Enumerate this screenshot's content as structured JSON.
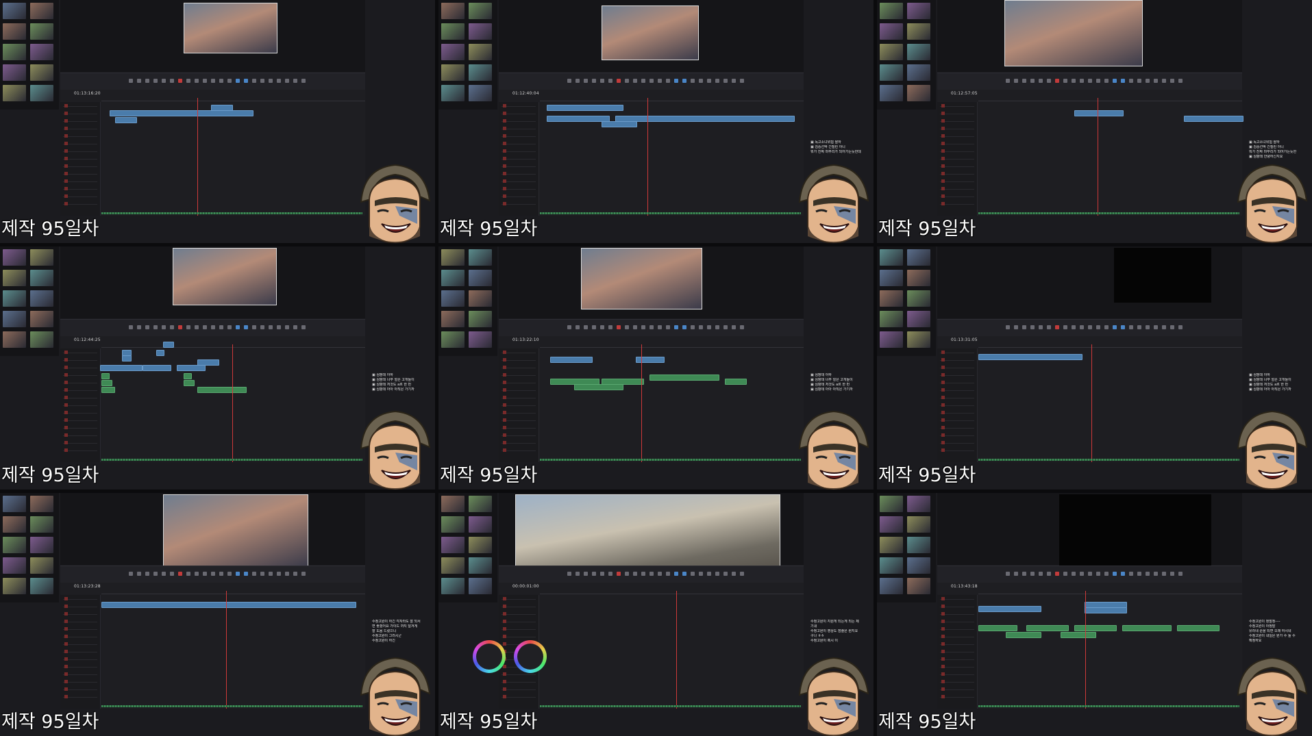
{
  "caption": "제작 95일차",
  "colors": {
    "playhead": "#d13a3a",
    "video_clip": "#4a7cab",
    "audio_clip": "#3f8a55",
    "panel_bg": "#1b1b1f"
  },
  "panels": [
    {
      "timecode": "01:13:16:20",
      "chat": []
    },
    {
      "timecode": "01:12:40:04",
      "chat": [
        "▣ 독고소녀위험 짤하",
        "▣ 김중선박 긴질린 아니",
        "뭐가 진짜 마무리가 되어가는듯한데"
      ]
    },
    {
      "timecode": "01:12:57:05",
      "chat": [
        "▣ 독고소녀위험 짤하",
        "▣ 김중선박 긴질린 아니",
        "뭐가 진짜 마무리가 되어가는듯한",
        "▣ 심팡데 안녕하신지요"
      ]
    },
    {
      "timecode": "01:12:44:25",
      "chat": [
        "▣ 심팡데 아하",
        "▣ 심팡데 너무 멀은 고개들이",
        "▣ 심팡데 저것도 a르 한 번",
        "▣ 심팡데 아아 아직은 가기까"
      ]
    },
    {
      "timecode": "01:13:22:10",
      "chat": [
        "▣ 심팡데 아하",
        "▣ 심팡데 너무 멀은 고개들이",
        "▣ 심팡데 저것도 a르 한 번",
        "▣ 심팡데 아아 아직은 가기까"
      ]
    },
    {
      "timecode": "01:13:31:05",
      "chat": [
        "▣ 심팡데 아하",
        "▣ 심팡데 너무 멀은 고개들이",
        "▣ 심팡데 저것도 a르 한 번",
        "▣ 심팡데 아아 아직은 가기까"
      ]
    },
    {
      "timecode": "01:13:23:28",
      "chat": [
        "수정고원이 하긴 각자라도 잘 되서",
        "면 좋겠어요 가이드 까지 달겨게",
        "잘 도움 드렸으니",
        "수정고원이 그러시군",
        "수정고원이 하긴"
      ]
    },
    {
      "timecode": "00:00:01:00",
      "chat": [
        "수정고원이 지원게 되는게 되는 제",
        "기내",
        "수정고원이 영상도 잠줄은 뭔지요",
        "구나 ㅎㅎ",
        "수정고원이 혹시 이"
      ]
    },
    {
      "timecode": "01:13:43:18",
      "chat": [
        "수정고원이 정말정----",
        "수정고원이 아정말",
        "유라네 순을 되면 오래 하시네",
        "수정고원이 내일은 뭔가 수 돌 수",
        "확정하요"
      ]
    }
  ]
}
